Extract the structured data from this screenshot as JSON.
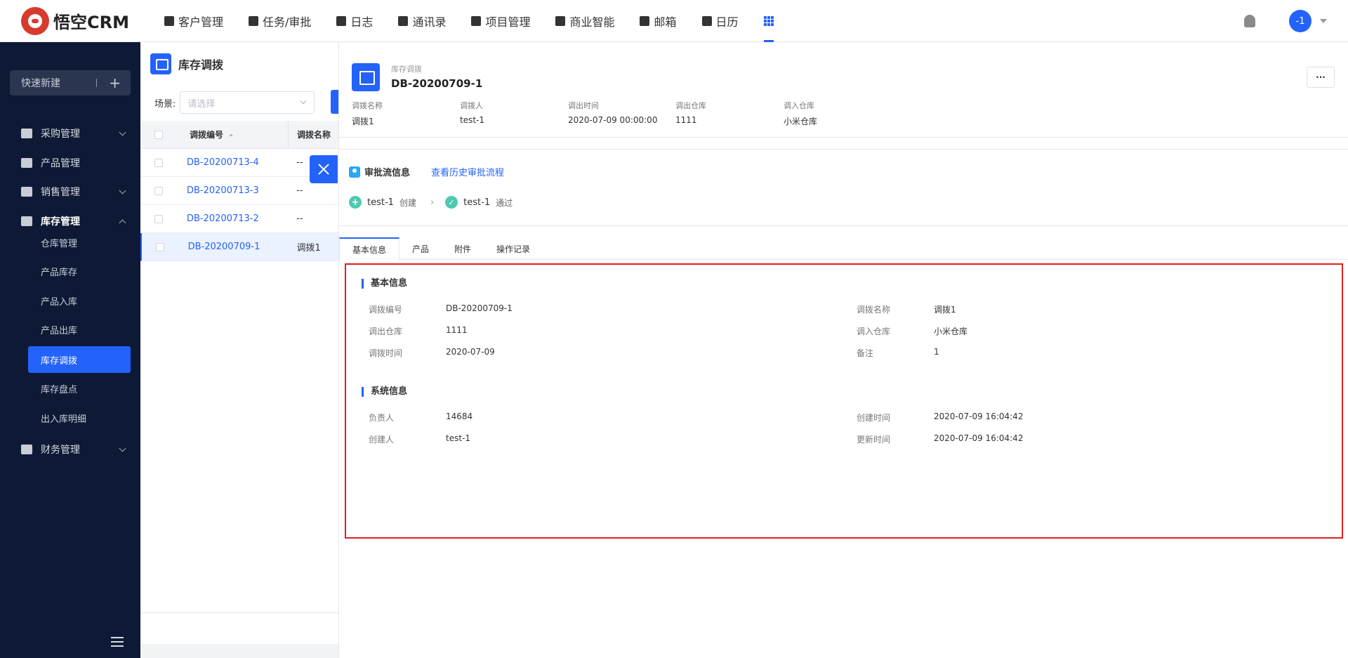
{
  "brand": {
    "name": "悟空CRM"
  },
  "topnav": {
    "items": [
      {
        "label": "客户管理",
        "icon": "building-icon"
      },
      {
        "label": "任务/审批",
        "icon": "briefcase-icon"
      },
      {
        "label": "日志",
        "icon": "notebook-icon"
      },
      {
        "label": "通讯录",
        "icon": "contacts-icon"
      },
      {
        "label": "项目管理",
        "icon": "project-icon"
      },
      {
        "label": "商业智能",
        "icon": "bi-icon"
      },
      {
        "label": "邮箱",
        "icon": "mail-icon"
      },
      {
        "label": "日历",
        "icon": "calendar-icon"
      }
    ],
    "avatar_text": "-1"
  },
  "sidebar": {
    "quick_new": "快速新建",
    "menus": [
      {
        "label": "采购管理"
      },
      {
        "label": "产品管理"
      },
      {
        "label": "销售管理"
      },
      {
        "label": "库存管理"
      },
      {
        "label": "财务管理"
      }
    ],
    "sub_items": [
      "仓库管理",
      "产品库存",
      "产品入库",
      "产品出库",
      "库存调拨",
      "库存盘点",
      "出入库明细"
    ]
  },
  "list": {
    "title": "库存调拨",
    "scene_label": "场景:",
    "scene_placeholder": "请选择",
    "columns": [
      "调拨编号",
      "调拨名称"
    ],
    "rows": [
      {
        "code": "DB-20200713-4",
        "name": "--"
      },
      {
        "code": "DB-20200713-3",
        "name": "--"
      },
      {
        "code": "DB-20200713-2",
        "name": "--"
      },
      {
        "code": "DB-20200709-1",
        "name": "调拨1"
      }
    ]
  },
  "detail": {
    "category": "库存调拨",
    "title": "DB-20200709-1",
    "more": "···",
    "header_fields": [
      {
        "label": "调拨名称",
        "value": "调拨1"
      },
      {
        "label": "调拨人",
        "value": "test-1"
      },
      {
        "label": "调出时间",
        "value": "2020-07-09 00:00:00"
      },
      {
        "label": "调出仓库",
        "value": "1111"
      },
      {
        "label": "调入仓库",
        "value": "小米仓库"
      }
    ],
    "approval": {
      "title": "审批流信息",
      "history_link": "查看历史审批流程",
      "step1_user": "test-1",
      "step1_action": "创建",
      "step2_user": "test-1",
      "step2_action": "通过"
    },
    "tabs": [
      "基本信息",
      "产品",
      "附件",
      "操作记录"
    ],
    "basic_title": "基本信息",
    "basic": [
      {
        "label": "调拨编号",
        "value": "DB-20200709-1"
      },
      {
        "label": "调拨名称",
        "value": "调拨1"
      },
      {
        "label": "调出仓库",
        "value": "1111"
      },
      {
        "label": "调入仓库",
        "value": "小米仓库"
      },
      {
        "label": "调拨时间",
        "value": "2020-07-09"
      },
      {
        "label": "备注",
        "value": "1"
      }
    ],
    "system_title": "系统信息",
    "system": [
      {
        "label": "负责人",
        "value": "14684"
      },
      {
        "label": "创建时间",
        "value": "2020-07-09 16:04:42"
      },
      {
        "label": "创建人",
        "value": "test-1"
      },
      {
        "label": "更新时间",
        "value": "2020-07-09 16:04:42"
      }
    ]
  }
}
